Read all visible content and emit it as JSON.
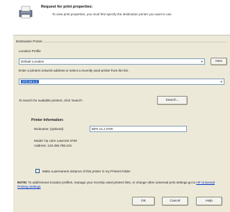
{
  "header": {
    "title": "Request for print properties:",
    "description": "To view print properties, you must first specify the destination printer you want to use."
  },
  "destination": {
    "group_label": "Destination Printer",
    "location_profile_label": "Location Profile",
    "location_profile_value": "Default Location",
    "new_button": "New",
    "address_instructions": "Enter a printers network address or select a recently used printer from the list.",
    "address_value": "172.19.1.1",
    "search_instructions": "To search for available printers, click 'Search'.",
    "search_button": "Search..."
  },
  "printer_info": {
    "heading": "Printer Information:",
    "nickname_label": "Nickname: (optional)",
    "nickname_value": "BiPs CLJ 3700",
    "model_line": "Model: hp color LaserJet 3700",
    "address_line": "Address: 123.456.789.123"
  },
  "permanent_checkbox_label": "Make a permanent instance of this printer in my Printers folder",
  "note": {
    "prefix": "NOTE:",
    "text": " To add/remove location profiles, manage your recently used printers lists, or change other universal print settings go to ",
    "link": "HP Universal Printing Settings"
  },
  "footer": {
    "ok": "OK",
    "cancel": "Cancel",
    "help": "Help"
  }
}
